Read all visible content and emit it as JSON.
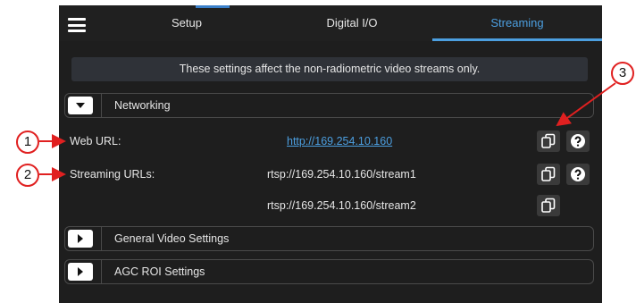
{
  "tabs": [
    {
      "label": "Setup"
    },
    {
      "label": "Digital I/O"
    },
    {
      "label": "Streaming"
    }
  ],
  "active_tab": "Streaming",
  "banner": "These settings affect the non-radiometric video streams only.",
  "sections": {
    "networking": {
      "title": "Networking",
      "expanded": true
    },
    "general_video": {
      "title": "General Video Settings",
      "expanded": false
    },
    "agc_roi": {
      "title": "AGC ROI Settings",
      "expanded": false
    }
  },
  "rows": {
    "web_url": {
      "label": "Web URL:",
      "value": "http://169.254.10.160"
    },
    "streaming_urls": {
      "label": "Streaming URLs:",
      "stream1": "rtsp://169.254.10.160/stream1",
      "stream2": "rtsp://169.254.10.160/stream2"
    }
  },
  "callouts": [
    "1",
    "2",
    "3"
  ],
  "colors": {
    "panel_bg": "#1e1e1e",
    "accent": "#4c9fe0",
    "annotation": "#e02020"
  },
  "icons": [
    "menu-icon",
    "chevron-down-icon",
    "chevron-right-icon",
    "copy-icon",
    "help-icon"
  ]
}
